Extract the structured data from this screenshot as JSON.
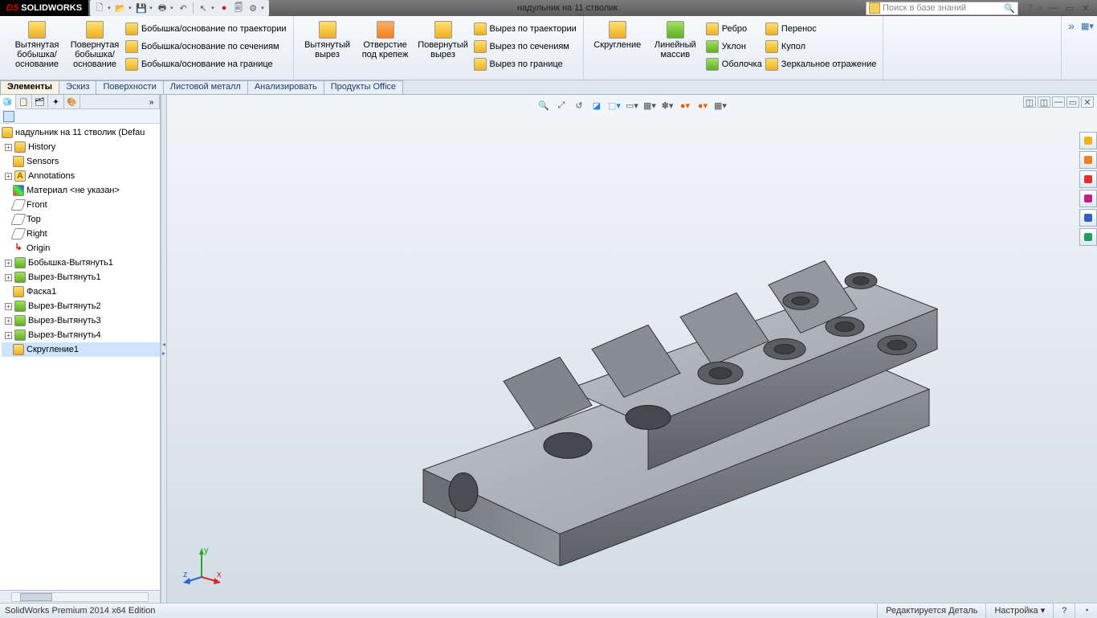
{
  "app": {
    "logo_ds": "DS",
    "logo_name": "SOLIDWORKS",
    "doc_title": "надульник  на 11 стволик"
  },
  "search": {
    "placeholder": "Поиск в базе знаний"
  },
  "ribbon": {
    "extrude_boss": "Вытянутая бобышка/основание",
    "revolve_boss": "Повернутая бобышка/основание",
    "sweep_boss": "Бобышка/основание по траектории",
    "loft_boss": "Бобышка/основание по сечениям",
    "boundary_boss": "Бобышка/основание на границе",
    "extrude_cut": "Вытянутый вырез",
    "hole": "Отверстие под крепеж",
    "revolve_cut": "Повернутый вырез",
    "sweep_cut": "Вырез по траектории",
    "loft_cut": "Вырез по сечениям",
    "boundary_cut": "Вырез по границе",
    "fillet": "Скругление",
    "pattern": "Линейный массив",
    "rib": "Ребро",
    "draft": "Уклон",
    "shell": "Оболочка",
    "wrap": "Перенос",
    "dome": "Купол",
    "mirror": "Зеркальное отражение"
  },
  "tabs": {
    "features": "Элементы",
    "sketch": "Эскиз",
    "surfaces": "Поверхности",
    "sheetmetal": "Листовой металл",
    "analyze": "Анализировать",
    "office": "Продукты Office"
  },
  "tree": {
    "root": "надульник  на 11 стволик  (Defau",
    "history": "History",
    "sensors": "Sensors",
    "annotations": "Annotations",
    "material": "Материал <не указан>",
    "front": "Front",
    "top": "Top",
    "right": "Right",
    "origin": "Origin",
    "f1": "Бобышка-Вытянуть1",
    "f2": "Вырез-Вытянуть1",
    "f3": "Фаска1",
    "f4": "Вырез-Вытянуть2",
    "f5": "Вырез-Вытянуть3",
    "f6": "Вырез-Вытянуть4",
    "f7": "Скругление1"
  },
  "triad": {
    "x": "x",
    "y": "y",
    "z": "z"
  },
  "status": {
    "edition": "SolidWorks Premium 2014 x64 Edition",
    "mode": "Редактируется Деталь",
    "custom": "Настройка"
  }
}
